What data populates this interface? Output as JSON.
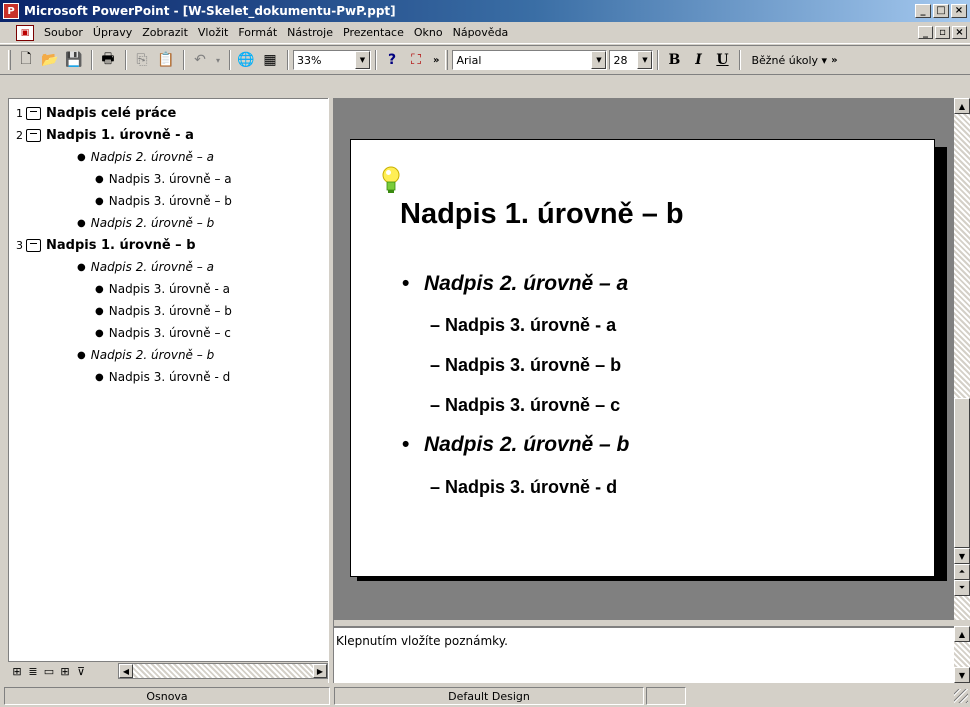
{
  "window": {
    "title": "Microsoft PowerPoint - [W-Skelet_dokumentu-PwP.ppt]",
    "min": "_",
    "max": "□",
    "close": "×",
    "doc_min": "_",
    "doc_restore": "▫",
    "doc_close": "×"
  },
  "menu": {
    "items": [
      "Soubor",
      "Úpravy",
      "Zobrazit",
      "Vložit",
      "Formát",
      "Nástroje",
      "Prezentace",
      "Okno",
      "Nápověda"
    ]
  },
  "toolbar": {
    "zoom": "33%",
    "font": "Arial",
    "size": "28",
    "bold": "B",
    "italic": "I",
    "underline": "U",
    "more": "»",
    "tasks": "Běžné úkoly ▾"
  },
  "outline": {
    "slides": [
      {
        "num": "1",
        "title": "Nadpis celé práce",
        "items": []
      },
      {
        "num": "2",
        "title": "Nadpis 1. úrovně - a",
        "items": [
          {
            "level": 2,
            "text": "Nadpis 2. úrovně – a"
          },
          {
            "level": 3,
            "text": "Nadpis 3. úrovně – a"
          },
          {
            "level": 3,
            "text": "Nadpis 3. úrovně – b"
          },
          {
            "level": 2,
            "text": "Nadpis 2. úrovně – b"
          }
        ]
      },
      {
        "num": "3",
        "title": "Nadpis 1. úrovně – b",
        "items": [
          {
            "level": 2,
            "text": "Nadpis 2. úrovně – a"
          },
          {
            "level": 3,
            "text": "Nadpis 3. úrovně - a"
          },
          {
            "level": 3,
            "text": "Nadpis 3. úrovně – b"
          },
          {
            "level": 3,
            "text": "Nadpis 3. úrovně – c"
          },
          {
            "level": 2,
            "text": "Nadpis 2. úrovně – b"
          },
          {
            "level": 3,
            "text": "Nadpis 3. úrovně - d"
          }
        ]
      }
    ]
  },
  "slide": {
    "title": "Nadpis 1. úrovně – b",
    "bullets": [
      {
        "level": 2,
        "text": "Nadpis 2. úrovně – a"
      },
      {
        "level": 3,
        "text": "Nadpis 3. úrovně - a"
      },
      {
        "level": 3,
        "text": "Nadpis 3. úrovně – b"
      },
      {
        "level": 3,
        "text": "Nadpis 3. úrovně – c"
      },
      {
        "level": 2,
        "text": "Nadpis 2. úrovně – b"
      },
      {
        "level": 3,
        "text": "Nadpis 3. úrovně - d"
      }
    ],
    "l2_bullet": "•",
    "l3_bullet": "–"
  },
  "notes": {
    "placeholder": "Klepnutím vložíte poznámky."
  },
  "status": {
    "view": "Osnova",
    "design": "Default Design"
  }
}
